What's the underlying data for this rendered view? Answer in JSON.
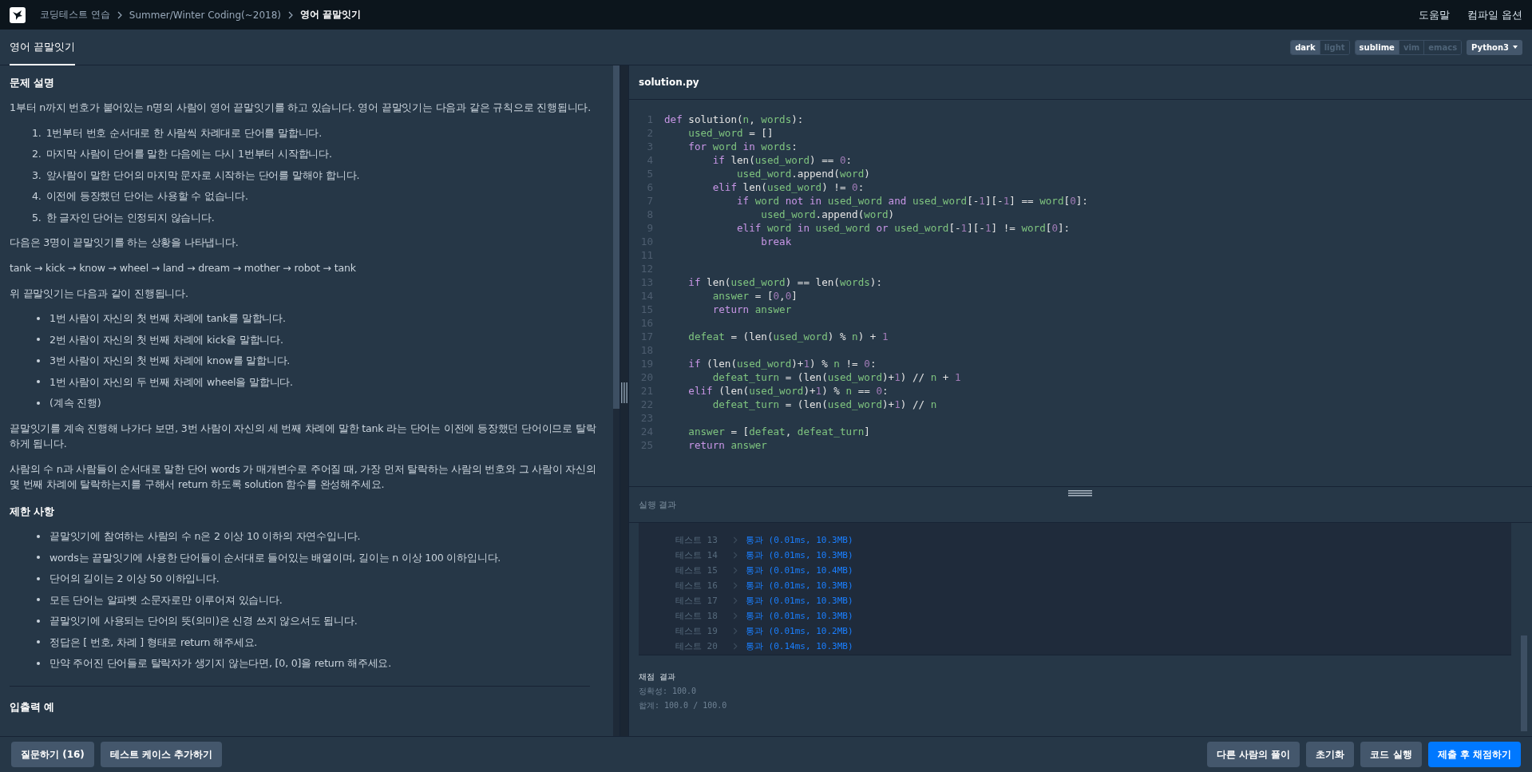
{
  "top_bar": {
    "breadcrumbs": [
      {
        "label": "코딩테스트 연습",
        "current": false
      },
      {
        "label": "Summer/Winter Coding(~2018)",
        "current": false
      },
      {
        "label": "영어 끝말잇기",
        "current": true
      }
    ],
    "links": [
      "도움말",
      "컴파일 옵션"
    ]
  },
  "tabs": [
    {
      "label": "영어 끝말잇기",
      "selected": true
    }
  ],
  "editor_options": {
    "theme": [
      {
        "label": "dark",
        "selected": true
      },
      {
        "label": "light",
        "selected": false
      }
    ],
    "keymap": [
      {
        "label": "sublime",
        "selected": true
      },
      {
        "label": "vim",
        "selected": false
      },
      {
        "label": "emacs",
        "selected": false
      }
    ],
    "language": "Python3"
  },
  "problem": {
    "sections": [
      {
        "heading": "문제 설명",
        "blocks": [
          {
            "kind": "paragraph",
            "text": "1부터 n까지 번호가 붙어있는 n명의 사람이 영어 끝말잇기를 하고 있습니다. 영어 끝말잇기는 다음과 같은 규칙으로 진행됩니다."
          },
          {
            "kind": "ordered",
            "items": [
              {
                "number": "1.",
                "text": "1번부터 번호 순서대로 한 사람씩 차례대로 단어를 말합니다."
              },
              {
                "number": "2.",
                "text": "마지막 사람이 단어를 말한 다음에는 다시 1번부터 시작합니다."
              },
              {
                "number": "3.",
                "text": "앞사람이 말한 단어의 마지막 문자로 시작하는 단어를 말해야 합니다."
              },
              {
                "number": "4.",
                "text": "이전에 등장했던 단어는 사용할 수 없습니다."
              },
              {
                "number": "5.",
                "text": "한 글자인 단어는 인정되지 않습니다."
              }
            ]
          },
          {
            "kind": "paragraph",
            "text": "다음은 3명이 끝말잇기를 하는 상황을 나타냅니다."
          },
          {
            "kind": "paragraph",
            "text": "tank → kick → know → wheel → land → dream → mother → robot → tank"
          },
          {
            "kind": "paragraph",
            "text": "위 끝말잇기는 다음과 같이 진행됩니다."
          },
          {
            "kind": "bullets",
            "items": [
              {
                "text": "1번 사람이 자신의 첫 번째 차례에 tank를 말합니다."
              },
              {
                "text": "2번 사람이 자신의 첫 번째 차례에 kick을 말합니다."
              },
              {
                "text": "3번 사람이 자신의 첫 번째 차례에 know를 말합니다."
              },
              {
                "text": "1번 사람이 자신의 두 번째 차례에 wheel을 말합니다."
              },
              {
                "text": "(계속 진행)"
              }
            ]
          },
          {
            "kind": "paragraph",
            "text": "끝말잇기를 계속 진행해 나가다 보면, 3번 사람이 자신의 세 번째 차례에 말한 tank 라는 단어는 이전에 등장했던 단어이므로 탈락하게 됩니다."
          },
          {
            "kind": "paragraph",
            "text": "사람의 수 n과 사람들이 순서대로 말한 단어 words 가 매개변수로 주어질 때, 가장 먼저 탈락하는 사람의 번호와 그 사람이 자신의 몇 번째 차례에 탈락하는지를 구해서 return 하도록 solution 함수를 완성해주세요."
          }
        ]
      },
      {
        "heading": "제한 사항",
        "blocks": [
          {
            "kind": "bullets",
            "items": [
              {
                "text": "끝말잇기에 참여하는 사람의 수 n은 2 이상 10 이하의 자연수입니다."
              },
              {
                "text": "words는 끝말잇기에 사용한 단어들이 순서대로 들어있는 배열이며, 길이는 n 이상 100 이하입니다."
              },
              {
                "text": "단어의 길이는 2 이상 50 이하입니다."
              },
              {
                "text": "모든 단어는 알파벳 소문자로만 이루어져 있습니다."
              },
              {
                "text": "끝말잇기에 사용되는 단어의 뜻(의미)은 신경 쓰지 않으셔도 됩니다."
              },
              {
                "text": "정답은 [ 번호, 차례 ] 형태로 return 해주세요."
              },
              {
                "text": "만약 주어진 단어들로 탈락자가 생기지 않는다면, [0, 0]을 return 해주세요."
              }
            ]
          },
          {
            "kind": "rule"
          }
        ]
      },
      {
        "heading": "입출력 예"
      }
    ]
  },
  "editor": {
    "filename": "solution.py",
    "lines": [
      {
        "number": "1",
        "tokens": [
          {
            "text": "def",
            "kind": "keyword"
          },
          {
            "text": " solution(",
            "kind": "plain"
          },
          {
            "text": "n",
            "kind": "name"
          },
          {
            "text": ", ",
            "kind": "plain"
          },
          {
            "text": "words",
            "kind": "name"
          },
          {
            "text": "):",
            "kind": "plain"
          }
        ]
      },
      {
        "number": "2",
        "tokens": [
          {
            "text": "    used_word",
            "kind": "name"
          },
          {
            "text": " = []",
            "kind": "plain"
          }
        ]
      },
      {
        "number": "3",
        "tokens": [
          {
            "text": "    for ",
            "kind": "keyword"
          },
          {
            "text": "word ",
            "kind": "name"
          },
          {
            "text": "in ",
            "kind": "keyword"
          },
          {
            "text": "words",
            "kind": "name"
          },
          {
            "text": ":",
            "kind": "plain"
          }
        ]
      },
      {
        "number": "4",
        "tokens": [
          {
            "text": "        if",
            "kind": "keyword"
          },
          {
            "text": " len(",
            "kind": "plain"
          },
          {
            "text": "used_word",
            "kind": "name"
          },
          {
            "text": ") == ",
            "kind": "plain"
          },
          {
            "text": "0",
            "kind": "number"
          },
          {
            "text": ":",
            "kind": "plain"
          }
        ]
      },
      {
        "number": "5",
        "tokens": [
          {
            "text": "            used_word",
            "kind": "name"
          },
          {
            "text": ".append(",
            "kind": "plain"
          },
          {
            "text": "word",
            "kind": "name"
          },
          {
            "text": ")",
            "kind": "plain"
          }
        ]
      },
      {
        "number": "6",
        "tokens": [
          {
            "text": "        elif",
            "kind": "keyword"
          },
          {
            "text": " len(",
            "kind": "plain"
          },
          {
            "text": "used_word",
            "kind": "name"
          },
          {
            "text": ") != ",
            "kind": "plain"
          },
          {
            "text": "0",
            "kind": "number"
          },
          {
            "text": ":",
            "kind": "plain"
          }
        ]
      },
      {
        "number": "7",
        "tokens": [
          {
            "text": "            if ",
            "kind": "keyword"
          },
          {
            "text": "word ",
            "kind": "name"
          },
          {
            "text": "not in ",
            "kind": "keyword"
          },
          {
            "text": "used_word ",
            "kind": "name"
          },
          {
            "text": "and ",
            "kind": "keyword"
          },
          {
            "text": "used_word",
            "kind": "name"
          },
          {
            "text": "[-",
            "kind": "plain"
          },
          {
            "text": "1",
            "kind": "number"
          },
          {
            "text": "][-",
            "kind": "plain"
          },
          {
            "text": "1",
            "kind": "number"
          },
          {
            "text": "] == ",
            "kind": "plain"
          },
          {
            "text": "word",
            "kind": "name"
          },
          {
            "text": "[",
            "kind": "plain"
          },
          {
            "text": "0",
            "kind": "number"
          },
          {
            "text": "]:",
            "kind": "plain"
          }
        ]
      },
      {
        "number": "8",
        "tokens": [
          {
            "text": "                used_word",
            "kind": "name"
          },
          {
            "text": ".append(",
            "kind": "plain"
          },
          {
            "text": "word",
            "kind": "name"
          },
          {
            "text": ")",
            "kind": "plain"
          }
        ]
      },
      {
        "number": "9",
        "tokens": [
          {
            "text": "            elif ",
            "kind": "keyword"
          },
          {
            "text": "word ",
            "kind": "name"
          },
          {
            "text": "in ",
            "kind": "keyword"
          },
          {
            "text": "used_word ",
            "kind": "name"
          },
          {
            "text": "or ",
            "kind": "keyword"
          },
          {
            "text": "used_word",
            "kind": "name"
          },
          {
            "text": "[-",
            "kind": "plain"
          },
          {
            "text": "1",
            "kind": "number"
          },
          {
            "text": "][-",
            "kind": "plain"
          },
          {
            "text": "1",
            "kind": "number"
          },
          {
            "text": "] != ",
            "kind": "plain"
          },
          {
            "text": "word",
            "kind": "name"
          },
          {
            "text": "[",
            "kind": "plain"
          },
          {
            "text": "0",
            "kind": "number"
          },
          {
            "text": "]:",
            "kind": "plain"
          }
        ]
      },
      {
        "number": "10",
        "tokens": [
          {
            "text": "                break",
            "kind": "keyword"
          }
        ]
      },
      {
        "number": "11"
      },
      {
        "number": "12"
      },
      {
        "number": "13",
        "tokens": [
          {
            "text": "    if",
            "kind": "keyword"
          },
          {
            "text": " len(",
            "kind": "plain"
          },
          {
            "text": "used_word",
            "kind": "name"
          },
          {
            "text": ") == len(",
            "kind": "plain"
          },
          {
            "text": "words",
            "kind": "name"
          },
          {
            "text": "):",
            "kind": "plain"
          }
        ]
      },
      {
        "number": "14",
        "tokens": [
          {
            "text": "        answer",
            "kind": "name"
          },
          {
            "text": " = [",
            "kind": "plain"
          },
          {
            "text": "0",
            "kind": "number"
          },
          {
            "text": ",",
            "kind": "plain"
          },
          {
            "text": "0",
            "kind": "number"
          },
          {
            "text": "]",
            "kind": "plain"
          }
        ]
      },
      {
        "number": "15",
        "tokens": [
          {
            "text": "        return ",
            "kind": "keyword"
          },
          {
            "text": "answer",
            "kind": "name"
          }
        ]
      },
      {
        "number": "16"
      },
      {
        "number": "17",
        "tokens": [
          {
            "text": "    defeat",
            "kind": "name"
          },
          {
            "text": " = (len(",
            "kind": "plain"
          },
          {
            "text": "used_word",
            "kind": "name"
          },
          {
            "text": ") % ",
            "kind": "plain"
          },
          {
            "text": "n",
            "kind": "name"
          },
          {
            "text": ") + ",
            "kind": "plain"
          },
          {
            "text": "1",
            "kind": "number"
          }
        ]
      },
      {
        "number": "18"
      },
      {
        "number": "19",
        "tokens": [
          {
            "text": "    if",
            "kind": "keyword"
          },
          {
            "text": " (len(",
            "kind": "plain"
          },
          {
            "text": "used_word",
            "kind": "name"
          },
          {
            "text": ")+",
            "kind": "plain"
          },
          {
            "text": "1",
            "kind": "number"
          },
          {
            "text": ") % ",
            "kind": "plain"
          },
          {
            "text": "n",
            "kind": "name"
          },
          {
            "text": " != ",
            "kind": "plain"
          },
          {
            "text": "0",
            "kind": "number"
          },
          {
            "text": ":",
            "kind": "plain"
          }
        ]
      },
      {
        "number": "20",
        "tokens": [
          {
            "text": "        defeat_turn",
            "kind": "name"
          },
          {
            "text": " = (len(",
            "kind": "plain"
          },
          {
            "text": "used_word",
            "kind": "name"
          },
          {
            "text": ")+",
            "kind": "plain"
          },
          {
            "text": "1",
            "kind": "number"
          },
          {
            "text": ") // ",
            "kind": "plain"
          },
          {
            "text": "n",
            "kind": "name"
          },
          {
            "text": " + ",
            "kind": "plain"
          },
          {
            "text": "1",
            "kind": "number"
          }
        ]
      },
      {
        "number": "21",
        "tokens": [
          {
            "text": "    elif",
            "kind": "keyword"
          },
          {
            "text": " (len(",
            "kind": "plain"
          },
          {
            "text": "used_word",
            "kind": "name"
          },
          {
            "text": ")+",
            "kind": "plain"
          },
          {
            "text": "1",
            "kind": "number"
          },
          {
            "text": ") % ",
            "kind": "plain"
          },
          {
            "text": "n",
            "kind": "name"
          },
          {
            "text": " == ",
            "kind": "plain"
          },
          {
            "text": "0",
            "kind": "number"
          },
          {
            "text": ":",
            "kind": "plain"
          }
        ]
      },
      {
        "number": "22",
        "tokens": [
          {
            "text": "        defeat_turn",
            "kind": "name"
          },
          {
            "text": " = (len(",
            "kind": "plain"
          },
          {
            "text": "used_word",
            "kind": "name"
          },
          {
            "text": ")+",
            "kind": "plain"
          },
          {
            "text": "1",
            "kind": "number"
          },
          {
            "text": ") // ",
            "kind": "plain"
          },
          {
            "text": "n",
            "kind": "name"
          }
        ]
      },
      {
        "number": "23"
      },
      {
        "number": "24",
        "tokens": [
          {
            "text": "    answer",
            "kind": "name"
          },
          {
            "text": " = [",
            "kind": "plain"
          },
          {
            "text": "defeat",
            "kind": "name"
          },
          {
            "text": ", ",
            "kind": "plain"
          },
          {
            "text": "defeat_turn",
            "kind": "name"
          },
          {
            "text": "]",
            "kind": "plain"
          }
        ]
      },
      {
        "number": "25",
        "tokens": [
          {
            "text": "    return ",
            "kind": "keyword"
          },
          {
            "text": "answer",
            "kind": "name"
          }
        ]
      }
    ]
  },
  "results": {
    "title": "실행 결과",
    "rows": [
      {
        "label": "테스트 13",
        "result": "통과 (0.01ms, 10.3MB)"
      },
      {
        "label": "테스트 14",
        "result": "통과 (0.01ms, 10.3MB)"
      },
      {
        "label": "테스트 15",
        "result": "통과 (0.01ms, 10.4MB)"
      },
      {
        "label": "테스트 16",
        "result": "통과 (0.01ms, 10.3MB)"
      },
      {
        "label": "테스트 17",
        "result": "통과 (0.01ms, 10.3MB)"
      },
      {
        "label": "테스트 18",
        "result": "통과 (0.01ms, 10.3MB)"
      },
      {
        "label": "테스트 19",
        "result": "통과 (0.01ms, 10.2MB)"
      },
      {
        "label": "테스트 20",
        "result": "통과 (0.14ms, 10.3MB)"
      }
    ],
    "grading_title": "채점 결과",
    "grading_lines": [
      "정확성: 100.0",
      "합계: 100.0 / 100.0"
    ]
  },
  "bottom_bar": {
    "left_buttons": [
      {
        "label": "질문하기 (16)",
        "kind": "secondary"
      },
      {
        "label": "테스트 케이스 추가하기",
        "kind": "secondary"
      }
    ],
    "right_buttons": [
      {
        "label": "다른 사람의 풀이",
        "kind": "secondary"
      },
      {
        "label": "초기화",
        "kind": "secondary"
      },
      {
        "label": "코드 실행",
        "kind": "secondary"
      },
      {
        "label": "제출 후 채점하기",
        "kind": "primary"
      }
    ]
  }
}
